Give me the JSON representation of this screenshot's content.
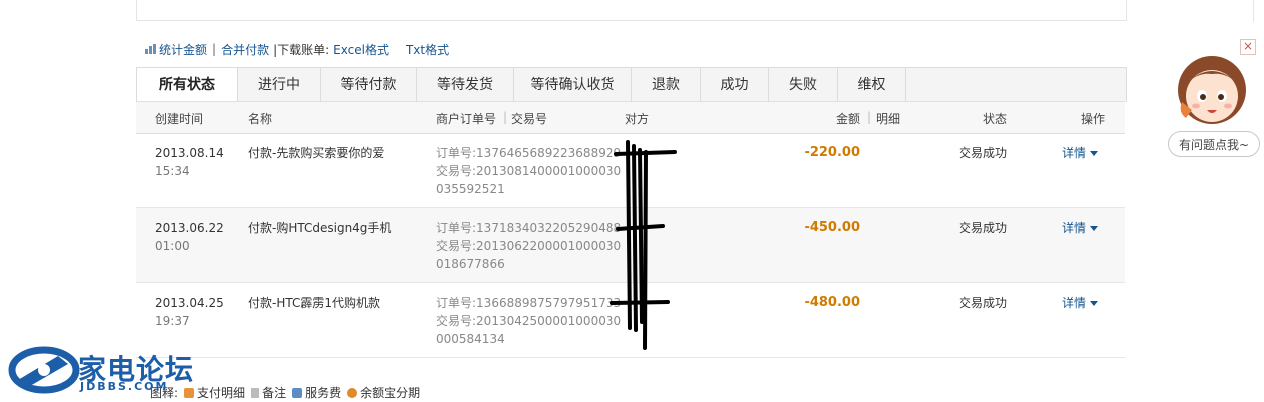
{
  "toolbar": {
    "stats_label": "统计金额",
    "merge_label": "合并付款",
    "download_label": "|下载账单:",
    "excel_label": "Excel格式",
    "txt_label": "Txt格式"
  },
  "tabs": [
    {
      "label": "所有状态",
      "active": true
    },
    {
      "label": "进行中"
    },
    {
      "label": "等待付款"
    },
    {
      "label": "等待发货"
    },
    {
      "label": "等待确认收货"
    },
    {
      "label": "退款"
    },
    {
      "label": "成功"
    },
    {
      "label": "失败"
    },
    {
      "label": "维权"
    }
  ],
  "table": {
    "headers": {
      "created": "创建时间",
      "name": "名称",
      "order_no": "商户订单号",
      "trade_no": "交易号",
      "counterparty": "对方",
      "amount": "金额",
      "detail": "明细",
      "status": "状态",
      "action": "操作"
    },
    "rows": [
      {
        "date": "2013.08.14",
        "time": "15:34",
        "name": "付款-先款购买索要你的爱",
        "order": "订单号:1376465689223688929",
        "trade1": "交易号:2013081400001000030",
        "trade2": "035592521",
        "amount": "-220.00",
        "status": "交易成功",
        "action": "详情"
      },
      {
        "date": "2013.06.22",
        "time": "01:00",
        "name": "付款-购HTCdesign4g手机",
        "order": "订单号:1371834032205290488",
        "trade1": "交易号:2013062200001000030",
        "trade2": "018677866",
        "amount": "-450.00",
        "status": "交易成功",
        "action": "详情"
      },
      {
        "date": "2013.04.25",
        "time": "19:37",
        "name": "付款-HTC霹雳1代购机款",
        "order": "订单号:1366889875797951733",
        "trade1": "交易号:2013042500001000030",
        "trade2": "000584134",
        "amount": "-480.00",
        "status": "交易成功",
        "action": "详情"
      }
    ]
  },
  "legend": {
    "prefix": "图释:",
    "items": [
      {
        "label": "支付明细",
        "color": "#e8913a"
      },
      {
        "label": "备注",
        "color": "#bbbbbb"
      },
      {
        "label": "服务费",
        "color": "#5b8cc4"
      },
      {
        "label": "余额宝分期",
        "color": "#e08a2a"
      }
    ]
  },
  "watermark": {
    "text": "家电论坛",
    "sub": "JDBBS.COM"
  },
  "helper": {
    "button_label": "有问题点我~",
    "close": "×"
  },
  "colors": {
    "link": "#15558f",
    "amount": "#d07a00",
    "tab_active_bg": "#ffffff"
  }
}
